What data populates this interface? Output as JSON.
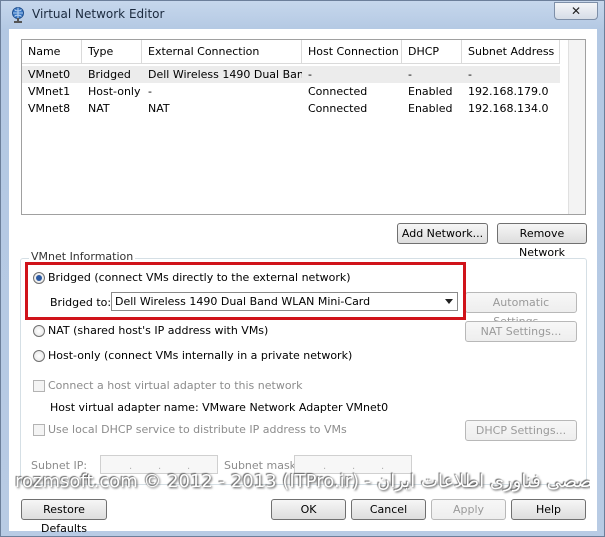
{
  "window": {
    "title": "Virtual Network Editor",
    "close_label": "✕"
  },
  "table": {
    "headers": [
      "Name",
      "Type",
      "External Connection",
      "Host Connection",
      "DHCP",
      "Subnet Address"
    ],
    "rows": [
      [
        "VMnet0",
        "Bridged",
        "Dell Wireless 1490 Dual Ban...",
        "-",
        "-",
        "-"
      ],
      [
        "VMnet1",
        "Host-only",
        "-",
        "Connected",
        "Enabled",
        "192.168.179.0"
      ],
      [
        "VMnet8",
        "NAT",
        "NAT",
        "Connected",
        "Enabled",
        "192.168.134.0"
      ]
    ]
  },
  "buttons": {
    "add_network": "Add Network...",
    "remove_network": "Remove Network",
    "automatic_settings": "Automatic Settings...",
    "nat_settings": "NAT Settings...",
    "dhcp_settings": "DHCP Settings...",
    "restore_defaults": "Restore Defaults",
    "ok": "OK",
    "cancel": "Cancel",
    "apply": "Apply",
    "help": "Help"
  },
  "vmnet_info": {
    "group_title": "VMnet Information",
    "bridged_label": "Bridged (connect VMs directly to the external network)",
    "bridged_to_label": "Bridged to:",
    "bridged_to_value": "Dell Wireless 1490 Dual Band WLAN Mini-Card",
    "nat_label": "NAT (shared host's IP address with VMs)",
    "hostonly_label": "Host-only (connect VMs internally in a private network)",
    "connect_adapter_label": "Connect a host virtual adapter to this network",
    "adapter_name_label": "Host virtual adapter name: VMware Network Adapter VMnet0",
    "dhcp_label": "Use local DHCP service to distribute IP address to VMs",
    "subnet_ip_label": "Subnet IP:",
    "subnet_mask_label": "Subnet mask:",
    "selected_mode": "bridged"
  },
  "watermark": "rozmsoft.com   © 2012 - 2013 (ITPro.ir) - انجمن تخصصی فناوری اطلاعات ایران",
  "colors": {
    "highlight": "#d0131a",
    "accent": "#2b5aa3"
  }
}
